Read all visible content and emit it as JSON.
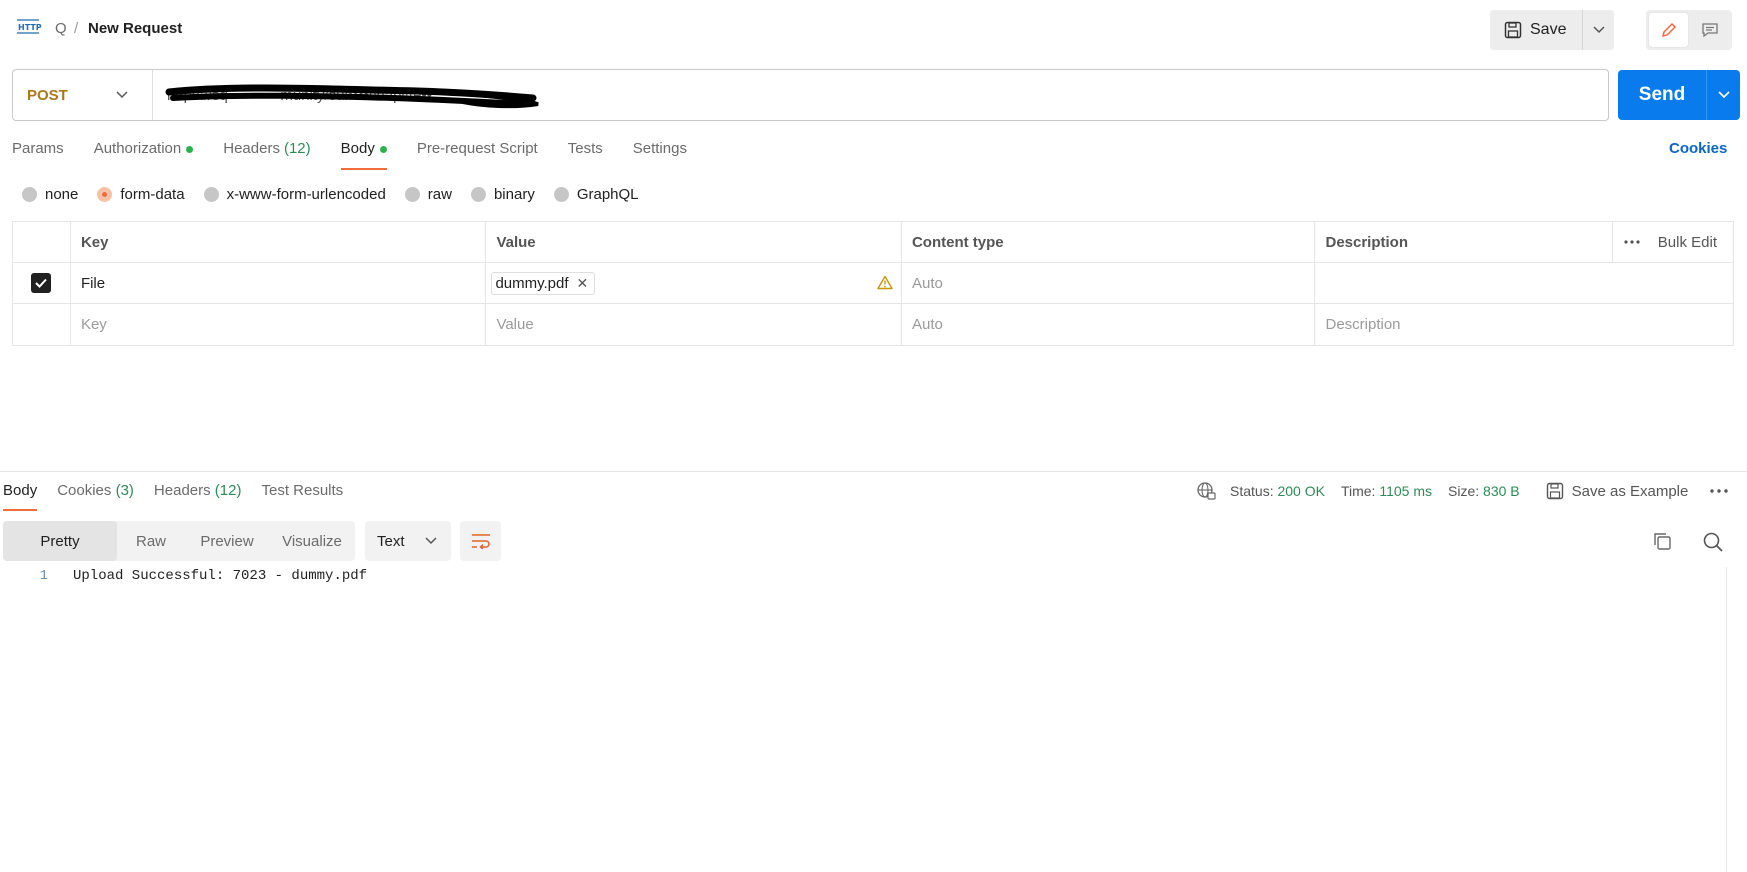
{
  "header": {
    "workspace_initial": "Q",
    "separator": "/",
    "title": "New Request",
    "save_label": "Save"
  },
  "request": {
    "method": "POST",
    "url": "https://sq••••••••••munity/sui••••chapi/te••",
    "send_label": "Send"
  },
  "tabs": {
    "params": "Params",
    "authorization": "Authorization",
    "headers": "Headers",
    "headers_count": "(12)",
    "body": "Body",
    "prerequest": "Pre-request Script",
    "tests": "Tests",
    "settings": "Settings",
    "cookies": "Cookies"
  },
  "body_types": [
    "none",
    "form-data",
    "x-www-form-urlencoded",
    "raw",
    "binary",
    "GraphQL"
  ],
  "form_table": {
    "headers": {
      "key": "Key",
      "value": "Value",
      "content_type": "Content type",
      "description": "Description",
      "bulk_edit": "Bulk Edit"
    },
    "rows": [
      {
        "key": "File",
        "file": "dummy.pdf",
        "content_type_placeholder": "Auto"
      }
    ],
    "empty_row": {
      "key": "Key",
      "value": "Value",
      "content_type": "Auto",
      "description": "Description"
    }
  },
  "response": {
    "tabs": {
      "body": "Body",
      "cookies": "Cookies",
      "cookies_count": "(3)",
      "headers": "Headers",
      "headers_count": "(12)",
      "tests": "Test Results"
    },
    "status_label": "Status:",
    "status_value": "200 OK",
    "time_label": "Time:",
    "time_value": "1105 ms",
    "size_label": "Size:",
    "size_value": "830 B",
    "save_example": "Save as Example",
    "view_tabs": [
      "Pretty",
      "Raw",
      "Preview",
      "Visualize"
    ],
    "format": "Text",
    "lines": [
      {
        "no": "1",
        "text": "Upload Successful: 7023 - dummy.pdf"
      }
    ]
  },
  "colors": {
    "accent": "#f26b3a",
    "send": "#097bed",
    "method": "#a9791c",
    "count": "#2e8b57"
  }
}
